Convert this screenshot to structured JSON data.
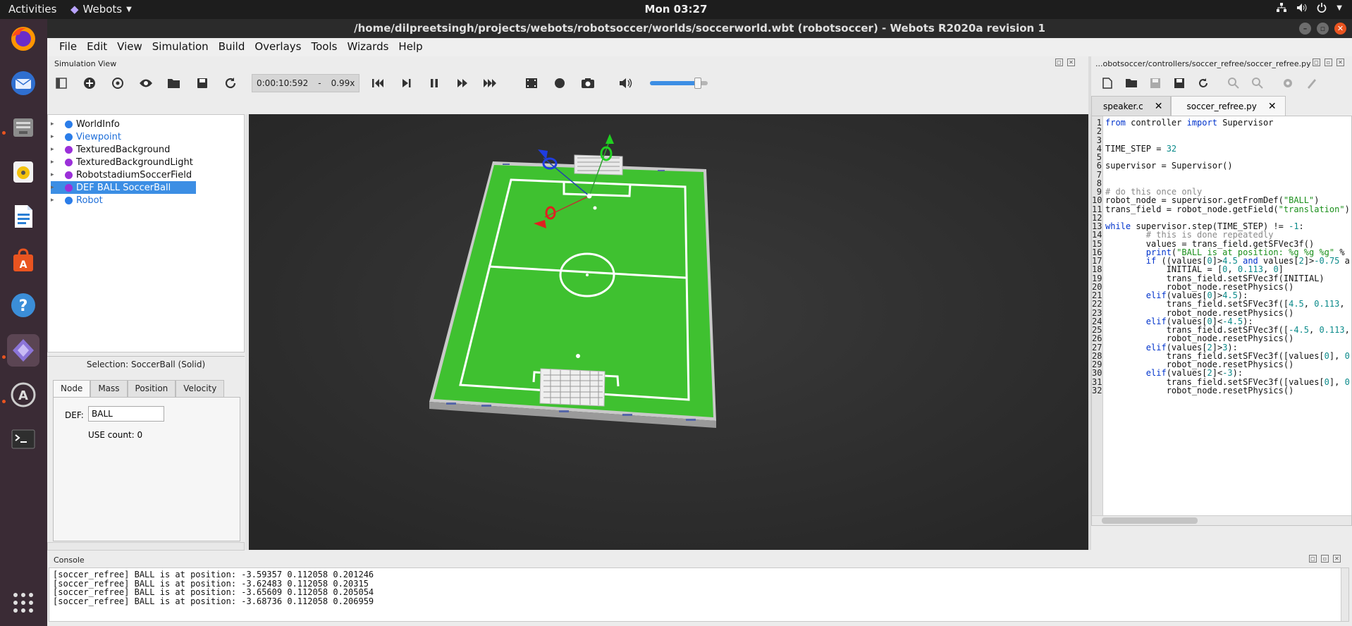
{
  "topbar": {
    "activities": "Activities",
    "app_name": "Webots",
    "clock": "Mon 03:27",
    "tray_icons": [
      "network-icon",
      "volume-icon",
      "power-icon",
      "chevron-down-icon"
    ]
  },
  "dock": {
    "apps": [
      {
        "name": "firefox-icon",
        "color": "#e66000"
      },
      {
        "name": "thunderbird-icon",
        "color": "#3a7bd5"
      },
      {
        "name": "files-icon",
        "color": "#8a8a8a"
      },
      {
        "name": "rhythmbox-icon",
        "color": "#f4c20d"
      },
      {
        "name": "writer-icon",
        "color": "#2a7fd4"
      },
      {
        "name": "software-icon",
        "color": "#e95420"
      },
      {
        "name": "help-icon",
        "color": "#3b8ed8"
      },
      {
        "name": "webots-icon",
        "color": "#6c4ab5"
      },
      {
        "name": "updater-icon",
        "color": "#777777"
      },
      {
        "name": "terminal-icon",
        "color": "#2e2e2e"
      }
    ],
    "show_apps_icon": "grid-icon"
  },
  "window": {
    "title": "/home/dilpreetsingh/projects/webots/robotsoccer/worlds/soccerworld.wbt (robotsoccer) - Webots R2020a revision 1",
    "menus": [
      "File",
      "Edit",
      "View",
      "Simulation",
      "Build",
      "Overlays",
      "Tools",
      "Wizards",
      "Help"
    ]
  },
  "simview": {
    "title": "Simulation View",
    "time": "0:00:10:592",
    "time_sep": "-",
    "speed": "0.99x",
    "volume_fraction": 0.82
  },
  "scene_tree": {
    "items": [
      {
        "label": "WorldInfo",
        "color": "#2b7de9",
        "label_blue": false,
        "selected": false
      },
      {
        "label": "Viewpoint",
        "color": "#2b7de9",
        "label_blue": true,
        "selected": false
      },
      {
        "label": "TexturedBackground",
        "color": "#9b30d9",
        "label_blue": false,
        "selected": false
      },
      {
        "label": "TexturedBackgroundLight",
        "color": "#9b30d9",
        "label_blue": false,
        "selected": false
      },
      {
        "label": "RobotstadiumSoccerField",
        "color": "#9b30d9",
        "label_blue": false,
        "selected": false
      },
      {
        "label": "DEF BALL SoccerBall",
        "color": "#9b30d9",
        "label_blue": false,
        "selected": true
      },
      {
        "label": "Robot",
        "color": "#2b7de9",
        "label_blue": true,
        "selected": false
      }
    ]
  },
  "node_panel": {
    "selection": "Selection: SoccerBall (Solid)",
    "tabs": [
      "Node",
      "Mass",
      "Position",
      "Velocity"
    ],
    "def_label": "DEF:",
    "def_value": "BALL",
    "use_count": "USE count: 0"
  },
  "editor": {
    "title": "...obotsoccer/controllers/soccer_refree/soccer_refree.py",
    "tabs": [
      {
        "label": "speaker.c",
        "active": false
      },
      {
        "label": "soccer_refree.py",
        "active": true
      }
    ],
    "lines": [
      "from controller import Supervisor",
      "",
      "",
      "TIME_STEP = 32",
      "",
      "supervisor = Supervisor()",
      "",
      "",
      "# do this once only",
      "robot_node = supervisor.getFromDef(\"BALL\")",
      "trans_field = robot_node.getField(\"translation\")",
      "",
      "while supervisor.step(TIME_STEP) != -1:",
      "        # this is done repeatedly",
      "        values = trans_field.getSFVec3f()",
      "        print(\"BALL is at position: %g %g %g\" %",
      "        if ((values[0]>4.5 and values[2]>-0.75 a",
      "            INITIAL = [0, 0.113, 0]",
      "            trans_field.setSFVec3f(INITIAL)",
      "            robot_node.resetPhysics()",
      "        elif(values[0]>4.5):",
      "            trans_field.setSFVec3f([4.5, 0.113,",
      "            robot_node.resetPhysics()",
      "        elif(values[0]<-4.5):",
      "            trans_field.setSFVec3f([-4.5, 0.113,",
      "            robot_node.resetPhysics()",
      "        elif(values[2]>3):",
      "            trans_field.setSFVec3f([values[0], 0",
      "            robot_node.resetPhysics()",
      "        elif(values[2]<-3):",
      "            trans_field.setSFVec3f([values[0], 0",
      "            robot_node.resetPhysics()"
    ]
  },
  "console": {
    "title": "Console",
    "lines": [
      "[soccer_refree] BALL is at position: -3.59357 0.112058 0.201246",
      "[soccer_refree] BALL is at position: -3.62483 0.112058 0.20315",
      "[soccer_refree] BALL is at position: -3.65609 0.112058 0.205054",
      "[soccer_refree] BALL is at position: -3.68736 0.112058 0.206959"
    ]
  },
  "colors": {
    "accent": "#3c8ee4",
    "field_green": "#3fc130",
    "ubuntu_orange": "#e95420"
  }
}
